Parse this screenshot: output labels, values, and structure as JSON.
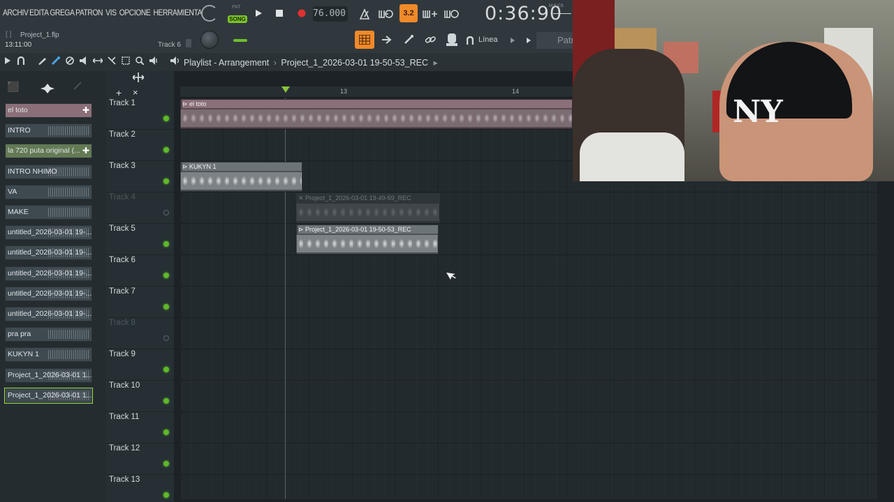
{
  "toolbar": {
    "menus": [
      "ARCHIV",
      "EDITA",
      "GREGA",
      "PATRON",
      "VIS",
      "OPCIONE",
      "HERRAMIENTA"
    ],
    "song_mode_label": "SONG",
    "pattern_mode_label": "PAT",
    "tempo": "76.000",
    "time": "0:36:90",
    "time_format": "M:S:CS",
    "snap_value": "3.2",
    "project_bracket": "[ ]",
    "project_file": "Project_1.flp",
    "clock": "13:11:00",
    "current_track": "Track 6",
    "snap_mode": "Línea",
    "pattern_selector": "Patr"
  },
  "playlist": {
    "title": "Playlist - Arrangement",
    "separator": "›",
    "arrangement": "Project_1_2026-03-01 19-50-53_REC",
    "ruler": [
      {
        "bar": "13"
      },
      {
        "bar": "14"
      }
    ]
  },
  "picker": {
    "items": [
      {
        "label": "el toto",
        "kind": "pattern"
      },
      {
        "label": "INTRO",
        "kind": "audio"
      },
      {
        "label": "la 720 puta original (...",
        "kind": "pattern2"
      },
      {
        "label": "INTRO NHIMO",
        "kind": "audio"
      },
      {
        "label": "VA",
        "kind": "audio"
      },
      {
        "label": "MAKE",
        "kind": "audio"
      },
      {
        "label": "untitled_2026-03-01 19-...",
        "kind": "audio"
      },
      {
        "label": "untitled_2026-03-01 19-...",
        "kind": "audio"
      },
      {
        "label": "untitled_2026-03-01 19-...",
        "kind": "audio"
      },
      {
        "label": "untitled_2026-03-01 19-...",
        "kind": "audio"
      },
      {
        "label": "untitled_2026-03-01 19-...",
        "kind": "audio"
      },
      {
        "label": "pra pra",
        "kind": "audio"
      },
      {
        "label": "KUKYN 1",
        "kind": "audio"
      },
      {
        "label": "Project_1_2026-03-01 1...",
        "kind": "audio"
      },
      {
        "label": "Project_1_2026-03-01 1...",
        "kind": "audio",
        "selected": true
      }
    ]
  },
  "tracks": [
    {
      "name": "Track 1",
      "muted": false
    },
    {
      "name": "Track 2",
      "muted": false
    },
    {
      "name": "Track 3",
      "muted": false
    },
    {
      "name": "Track 4",
      "muted": true
    },
    {
      "name": "Track 5",
      "muted": false
    },
    {
      "name": "Track 6",
      "muted": false
    },
    {
      "name": "Track 7",
      "muted": false
    },
    {
      "name": "Track 8",
      "muted": true
    },
    {
      "name": "Track 9",
      "muted": false
    },
    {
      "name": "Track 10",
      "muted": false
    },
    {
      "name": "Track 11",
      "muted": false
    },
    {
      "name": "Track 12",
      "muted": false
    },
    {
      "name": "Track 13",
      "muted": false
    }
  ],
  "clips": [
    {
      "label": "el toto",
      "track": 1,
      "style": "pink"
    },
    {
      "label": "KUKYN 1",
      "track": 3,
      "style": "grey"
    },
    {
      "label": "Project_1_2026-03-01 19-49-59_REC",
      "track": 4,
      "style": "dim"
    },
    {
      "label": "Project_1_2026-03-01 19-50-53_REC",
      "track": 5,
      "style": "grey"
    }
  ],
  "colors": {
    "accent_green": "#7cc427",
    "record_red": "#e03030",
    "snap_orange": "#f08a2a"
  }
}
